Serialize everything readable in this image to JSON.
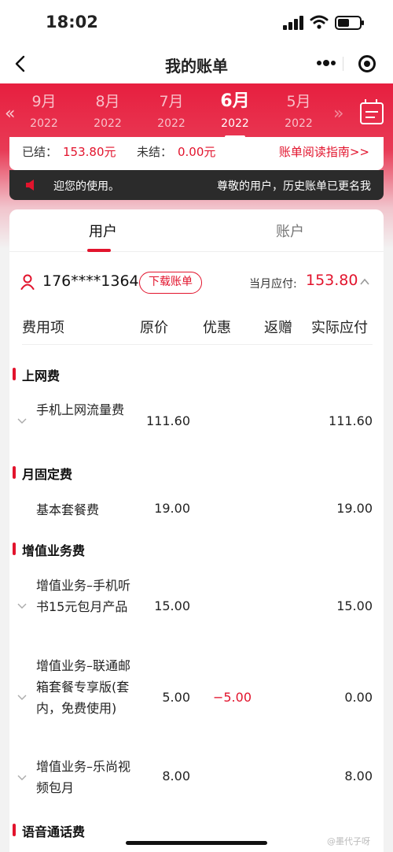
{
  "status_bar": {
    "time": "18:02"
  },
  "nav": {
    "title": "我的账单"
  },
  "months": [
    {
      "month": "9月",
      "year": "2022",
      "active": false
    },
    {
      "month": "8月",
      "year": "2022",
      "active": false
    },
    {
      "month": "7月",
      "year": "2022",
      "active": false
    },
    {
      "month": "6月",
      "year": "2022",
      "active": true
    },
    {
      "month": "5月",
      "year": "2022",
      "active": false
    }
  ],
  "summary": {
    "settled_label": "已结：",
    "settled_value": "153.80元",
    "unsettled_label": "未结：",
    "unsettled_value": "0.00元",
    "guide_link": "账单阅读指南>>"
  },
  "notice": {
    "text_left": "迎您的使用。",
    "text_right": "尊敬的用户，历史账单已更名我"
  },
  "tabs": [
    {
      "label": "用户",
      "active": true
    },
    {
      "label": "账户",
      "active": false
    }
  ],
  "account": {
    "phone": "176****1364",
    "download_button": "下载账单",
    "due_label": "当月应付:",
    "due_value": "153.80"
  },
  "table": {
    "headers": [
      "费用项",
      "原价",
      "优惠",
      "返赠",
      "实际应付"
    ]
  },
  "sections": [
    {
      "title": "上网费",
      "rows": [
        {
          "name": "手机上网流量费",
          "original": "111.60",
          "discount": "",
          "rebate": "",
          "actual": "111.60"
        }
      ]
    },
    {
      "title": "月固定费",
      "rows": [
        {
          "name": "基本套餐费",
          "original": "19.00",
          "discount": "",
          "rebate": "",
          "actual": "19.00"
        }
      ]
    },
    {
      "title": "增值业务费",
      "rows": [
        {
          "name": "增值业务–手机听书15元包月产品",
          "original": "15.00",
          "discount": "",
          "rebate": "",
          "actual": "15.00"
        },
        {
          "name": "增值业务–联通邮箱套餐专享版(套内，免费使用)",
          "original": "5.00",
          "discount": "−5.00",
          "rebate": "",
          "actual": "0.00"
        },
        {
          "name": "增值业务–乐尚视频包月",
          "original": "8.00",
          "discount": "",
          "rebate": "",
          "actual": "8.00"
        }
      ]
    },
    {
      "title": "语音通话费",
      "rows": []
    }
  ],
  "watermark": "@墨代子呀",
  "colors": {
    "accent": "#e2142d",
    "band": "#e71f3f"
  }
}
